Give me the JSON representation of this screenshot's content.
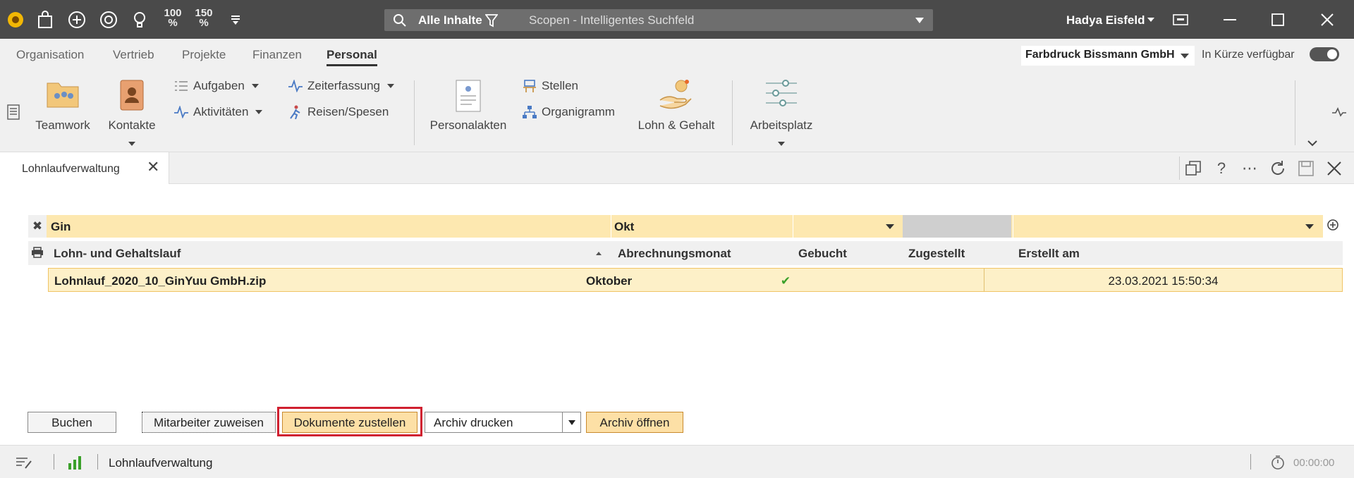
{
  "titlebar": {
    "zoom_options": [
      "100\n%",
      "150\n%"
    ],
    "search": {
      "scope": "Alle Inhalte",
      "placeholder": "Scopen - Intelligentes Suchfeld"
    },
    "user": "Hadya Eisfeld"
  },
  "menu": {
    "items": [
      "Organisation",
      "Vertrieb",
      "Projekte",
      "Finanzen",
      "Personal"
    ],
    "active": "Personal",
    "company": "Farbdruck Bissmann GmbH",
    "soon_label": "In Kürze verfügbar"
  },
  "ribbon": {
    "teamwork": "Teamwork",
    "kontakte": "Kontakte",
    "aufgaben": "Aufgaben",
    "aktivitaeten": "Aktivitäten",
    "zeiterfassung": "Zeiterfassung",
    "reisen": "Reisen/Spesen",
    "personalakten": "Personalakten",
    "stellen": "Stellen",
    "organigramm": "Organigramm",
    "lohn": "Lohn & Gehalt",
    "arbeitsplatz": "Arbeitsplatz"
  },
  "tab": {
    "label": "Lohnlaufverwaltung"
  },
  "grid": {
    "filters": {
      "lauf": "Gin",
      "monat": "Okt",
      "gebucht": "",
      "zugestellt": "",
      "erstellt": ""
    },
    "columns": [
      "Lohn- und Gehaltslauf",
      "Abrechnungsmonat",
      "Gebucht",
      "Zugestellt",
      "Erstellt am"
    ],
    "rows": [
      {
        "lauf": "Lohnlauf_2020_10_GinYuu GmbH.zip",
        "monat": "Oktober",
        "gebucht": "✔",
        "zugestellt": "",
        "erstellt": "23.03.2021 15:50:34"
      }
    ]
  },
  "buttons": {
    "buchen": "Buchen",
    "zuweisen": "Mitarbeiter zuweisen",
    "zustellen": "Dokumente zustellen",
    "drucken": "Archiv drucken",
    "oeffnen": "Archiv öffnen"
  },
  "status": {
    "view": "Lohnlaufverwaltung",
    "timer": "00:00:00"
  },
  "colors": {
    "accent": "#fde0a6",
    "highlight": "#d02030",
    "titlebar": "#4a4a4a",
    "check": "#3aa02a"
  }
}
